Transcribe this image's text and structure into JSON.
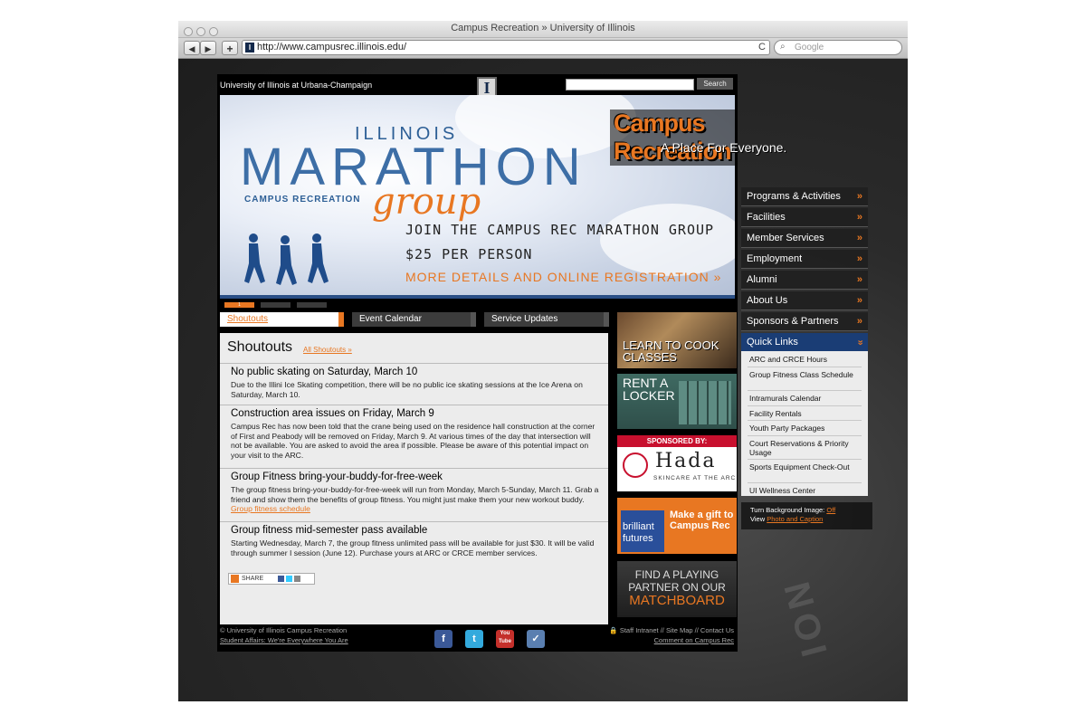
{
  "browser": {
    "window_title": "Campus Recreation » University of Illinois",
    "back": "◀",
    "forward": "▶",
    "add_bookmark": "+",
    "url": "http://www.campusrec.illinois.edu/",
    "reload": "C",
    "search_placeholder": "Google"
  },
  "header": {
    "university": "University of Illinois at Urbana-Champaign",
    "logo_letter": "I",
    "search_button": "Search",
    "site_title": "Campus Recreation",
    "tagline": "A Place For Everyone."
  },
  "hero": {
    "illinois": "ILLINOIS",
    "marathon": "MARATHON",
    "campus_rec": "CAMPUS RECREATION",
    "group": "group",
    "join": "JOIN THE CAMPUS REC MARATHON GROUP",
    "price": "$25 PER PERSON",
    "more": "MORE DETAILS AND ONLINE REGISTRATION »",
    "active_slide": "1"
  },
  "tabs": [
    {
      "label": "Shoutouts"
    },
    {
      "label": "Event Calendar"
    },
    {
      "label": "Service Updates"
    }
  ],
  "shoutouts": {
    "title": "Shoutouts",
    "all_link": "All Shoutouts »",
    "items": [
      {
        "title": "No public skating on Saturday, March 10",
        "body": "Due to the Illini Ice Skating competition, there will be no public ice skating sessions at the Ice Arena on Saturday, March 10."
      },
      {
        "title": "Construction area issues on Friday, March 9",
        "body": "Campus Rec has now been told that the crane being used on the residence hall construction at the corner of First and Peabody will be removed on Friday, March 9. At various times of the day that intersection will not be available. You are asked to avoid the area if possible. Please be aware of this potential impact on your visit to the ARC."
      },
      {
        "title": "Group Fitness bring-your-buddy-for-free-week",
        "body": "The group fitness bring-your-buddy-for-free-week will run from Monday, March 5-Sunday, March 11. Grab a friend and show them the benefits of group fitness. You might just make them your new workout buddy.",
        "link": "Group fitness schedule"
      },
      {
        "title": "Group fitness mid-semester pass available",
        "body": "Starting Wednesday, March 7, the group fitness unlimited pass will be available for just $30. It will be valid through summer I session (June 12). Purchase yours at ARC or CRCE member services."
      }
    ],
    "share": "SHARE"
  },
  "ads": {
    "cook": "LEARN TO COOK CLASSES",
    "locker_1": "RENT A",
    "locker_2": "LOCKER",
    "sponsored": "SPONSORED BY:",
    "hada": "Hada",
    "hada_sub": "SKINCARE AT THE ARC",
    "brilliant_1": "brilliant",
    "brilliant_2": "futures",
    "gift": "Make a gift to Campus Rec",
    "match_1": "FIND A PLAYING",
    "match_2": "PARTNER ON OUR",
    "match_3": "MATCHBOARD"
  },
  "menu": [
    {
      "label": "Programs & Activities"
    },
    {
      "label": "Facilities"
    },
    {
      "label": "Member Services"
    },
    {
      "label": "Employment"
    },
    {
      "label": "Alumni"
    },
    {
      "label": "About Us"
    },
    {
      "label": "Sponsors & Partners"
    },
    {
      "label": "Quick Links"
    }
  ],
  "quick_links": [
    "ARC and CRCE Hours",
    "Group Fitness Class Schedule",
    "Intramurals Calendar",
    "Facility Rentals",
    "Youth Party Packages",
    "Court Reservations & Priority Usage",
    "Sports Equipment Check-Out",
    "UI Wellness Center"
  ],
  "bg_toggle": {
    "label": "Turn Background Image:",
    "off": "Off",
    "view": "View",
    "photo": "Photo and Caption"
  },
  "footer": {
    "copyright": "© University of Illinois Campus Recreation",
    "student_affairs": "Student Affairs: We're Everywhere You Are",
    "links": "Staff Intranet // Site Map // Contact Us",
    "comment": "Comment on Campus Rec",
    "social": [
      "f",
      "t",
      "You Tube",
      "✓"
    ]
  },
  "colors": {
    "accent": "#e87722",
    "navy": "#13294b",
    "hero_blue": "#3d6ea6"
  }
}
